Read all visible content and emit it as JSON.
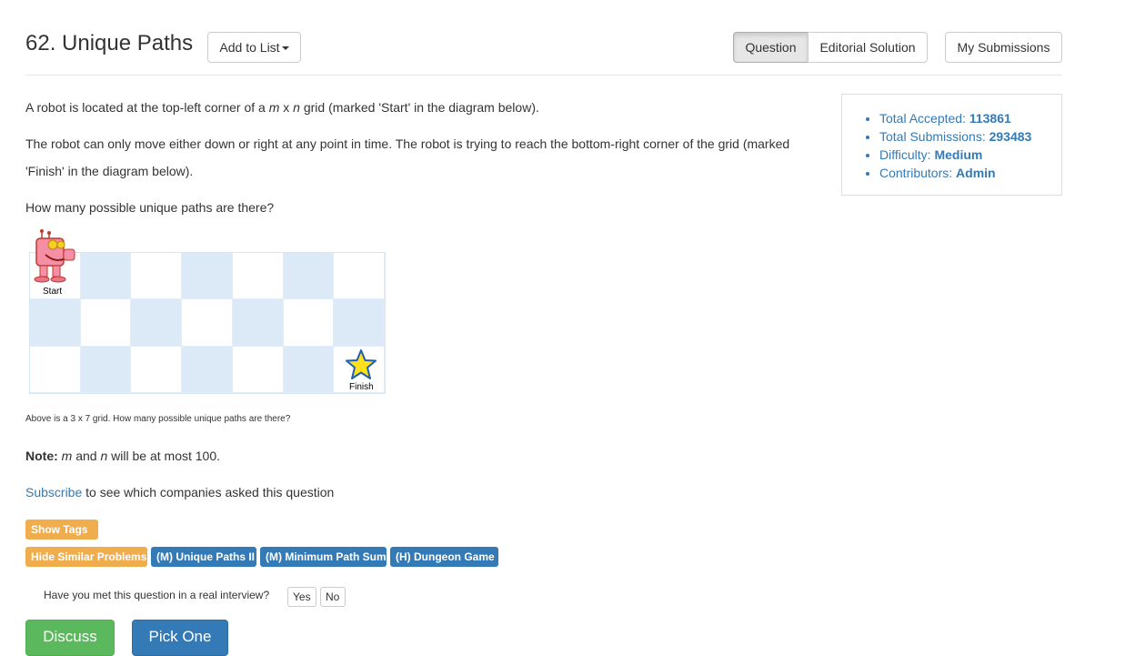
{
  "header": {
    "title": "62. Unique Paths",
    "add_to_list": "Add to List",
    "tabs": [
      "Question",
      "Editorial Solution"
    ],
    "my_submissions": "My Submissions"
  },
  "description": {
    "p1_before": "A robot is located at the top-left corner of a ",
    "p1_m": "m",
    "p1_x": " x ",
    "p1_n": "n",
    "p1_after": " grid (marked 'Start' in the diagram below).",
    "p2": "The robot can only move either down or right at any point in time. The robot is trying to reach the bottom-right corner of the grid (marked 'Finish' in the diagram below).",
    "p3": "How many possible unique paths are there?"
  },
  "diagram": {
    "start_label": "Start",
    "finish_label": "Finish",
    "rows": 3,
    "cols": 7,
    "caption": "Above is a 3 x 7 grid. How many possible unique paths are there?"
  },
  "note": {
    "label": "Note:",
    "m": "m",
    "and": " and ",
    "n": "n",
    "rest": " will be at most 100."
  },
  "subscribe": {
    "link": "Subscribe",
    "rest": " to see which companies asked this question"
  },
  "stats": {
    "accepted_label": "Total Accepted: ",
    "accepted_value": "113861",
    "submissions_label": "Total Submissions: ",
    "submissions_value": "293483",
    "difficulty_label": "Difficulty: ",
    "difficulty_value": "Medium",
    "contributors_label": "Contributors: ",
    "contributors_value": "Admin"
  },
  "tags": {
    "show_tags": "Show Tags",
    "hide_similar": "Hide Similar Problems",
    "similar": [
      "(M) Unique Paths II",
      "(M) Minimum Path Sum",
      "(H) Dungeon Game"
    ]
  },
  "interview": {
    "question": "Have you met this question in a real interview?",
    "yes": "Yes",
    "no": "No"
  },
  "actions": {
    "discuss": "Discuss",
    "pick_one": "Pick One"
  },
  "colors": {
    "accent": "#337ab7",
    "warning": "#f0ad4e",
    "success": "#5cb85c",
    "grid_blue": "#dce9f7"
  }
}
